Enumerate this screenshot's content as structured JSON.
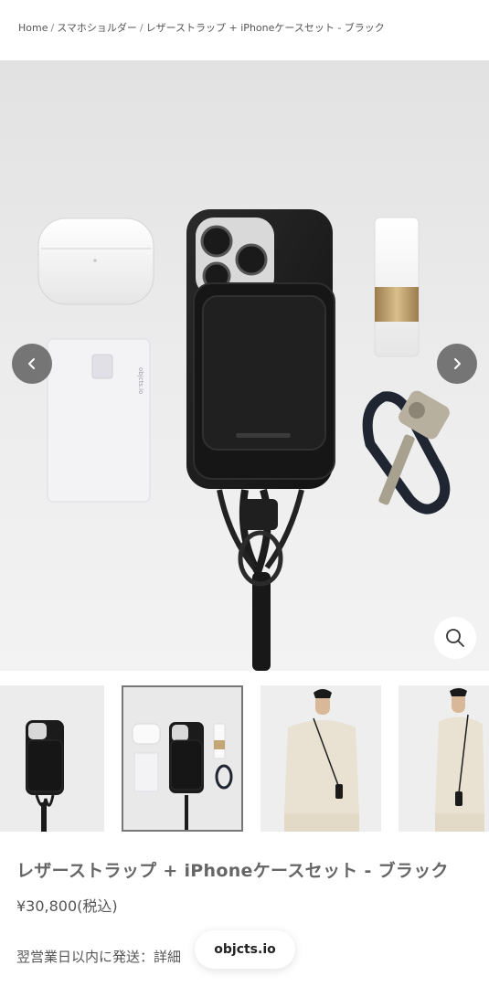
{
  "breadcrumb": {
    "home": "Home",
    "category": "スマホショルダー",
    "current": "レザーストラップ + iPhoneケースセット - ブラック",
    "separator": "/"
  },
  "gallery": {
    "icons": {
      "prev": "chevron-left-icon",
      "next": "chevron-right-icon",
      "zoom": "magnifier-icon"
    },
    "main_image": {
      "card_text": "objcts.io"
    },
    "thumbnails": [
      {
        "subject": "phone-case-with-strap"
      },
      {
        "subject": "flatlay-set",
        "selected": true
      },
      {
        "subject": "model-front"
      },
      {
        "subject": "model-side"
      }
    ]
  },
  "product": {
    "title": "レザーストラップ + iPhoneケースセット - ブラック",
    "price": "¥30,800(税込)",
    "shipping_note": "翌営業日以内に発送：詳細"
  },
  "site_badge": "objcts.io",
  "colors": {
    "button_overlay": "#5a5a5a",
    "leather": "#1c1c1c",
    "brass": "#b89a6a"
  }
}
